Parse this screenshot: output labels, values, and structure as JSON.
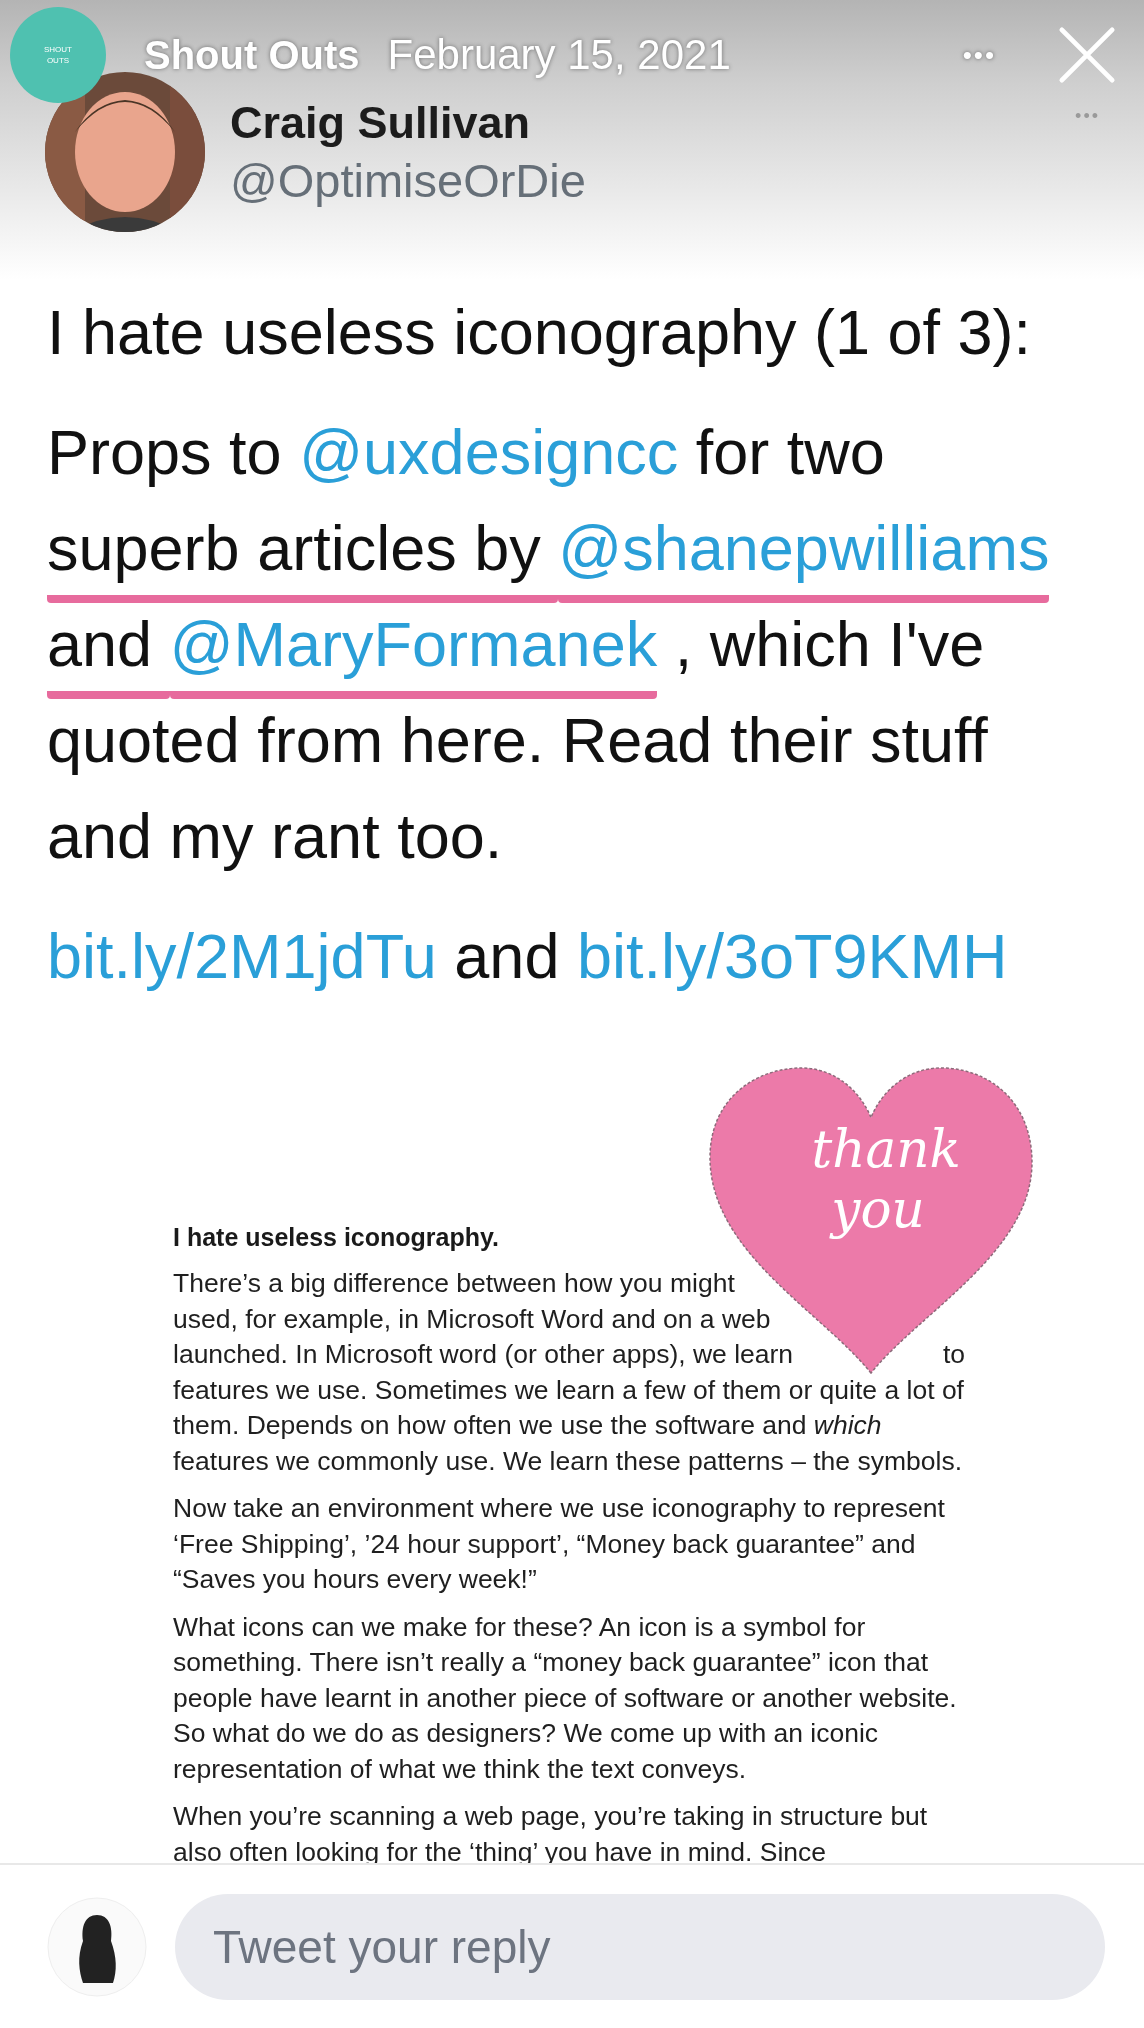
{
  "story_header": {
    "logo_text": "SHOUT OUTS",
    "account": "Shout Outs",
    "date": "February 15, 2021",
    "more": "•••"
  },
  "tweet": {
    "name": "Craig Sullivan",
    "handle": "@OptimiseOrDie",
    "menu": "•••",
    "paragraphs": [
      [
        {
          "segments": [
            {
              "kind": "text",
              "text": "I hate useless iconography (1 of 3):"
            }
          ]
        }
      ],
      [
        {
          "segments": [
            {
              "kind": "text",
              "text": "Props to "
            },
            {
              "kind": "mention",
              "text": "@uxdesigncc"
            },
            {
              "kind": "text",
              "text": " for two"
            }
          ]
        },
        {
          "segments": [
            {
              "kind": "text",
              "text": "superb articles by ",
              "underlined": true
            },
            {
              "kind": "mention",
              "text": "@shanepwilliams",
              "underlined": true
            }
          ]
        },
        {
          "segments": [
            {
              "kind": "text",
              "text": "and ",
              "underlined": true
            },
            {
              "kind": "mention",
              "text": "@MaryFormanek",
              "underlined": true
            },
            {
              "kind": "text",
              "text": " , which I've"
            }
          ]
        },
        {
          "segments": [
            {
              "kind": "text",
              "text": "quoted from here.  Read their stuff"
            }
          ]
        },
        {
          "segments": [
            {
              "kind": "text",
              "text": "and my rant too."
            }
          ]
        }
      ],
      [
        {
          "segments": [
            {
              "kind": "link",
              "text": "bit.ly/2M1jdTu"
            },
            {
              "kind": "text",
              "text": " and "
            },
            {
              "kind": "link",
              "text": "bit.ly/3oT9KMH"
            }
          ]
        }
      ]
    ]
  },
  "document": {
    "heading": "I hate useless iconography.",
    "paragraphs": [
      [
        {
          "text": "There’s a big difference between how you might"
        },
        {
          "text": "used, for example, in Microsoft Word and on a web"
        },
        {
          "text": "launched.  In Microsoft word (or other apps), we learn",
          "tail": "to"
        },
        {
          "text": "features we use.  Sometimes we learn a few of them or quite a lot of"
        },
        {
          "text": "them.  Depends on how often we use the software and *which*"
        },
        {
          "text": "features we commonly use.  We learn these patterns – the symbols."
        }
      ],
      [
        {
          "text": "Now take an environment where we use iconography to represent"
        },
        {
          "text": "‘Free Shipping’, ’24 hour support’, “Money back guarantee” and"
        },
        {
          "text": "“Saves you hours every week!”"
        }
      ],
      [
        {
          "text": "What icons can we make for these?  An icon is a symbol for"
        },
        {
          "text": "something.  There isn’t really a “money back guarantee” icon that"
        },
        {
          "text": "people have learnt in another piece of software or another website."
        },
        {
          "text": "So what do we do as designers?  We come up with an iconic"
        },
        {
          "text": "representation of what we think the text conveys."
        }
      ],
      [
        {
          "text": "When you’re scanning a web page, you’re taking in structure but"
        },
        {
          "text": "also often looking for the ‘thing’ you have in mind. Since"
        }
      ]
    ]
  },
  "sticker": {
    "lines": [
      "thank",
      "you"
    ]
  },
  "reply": {
    "placeholder": "Tweet your reply"
  }
}
